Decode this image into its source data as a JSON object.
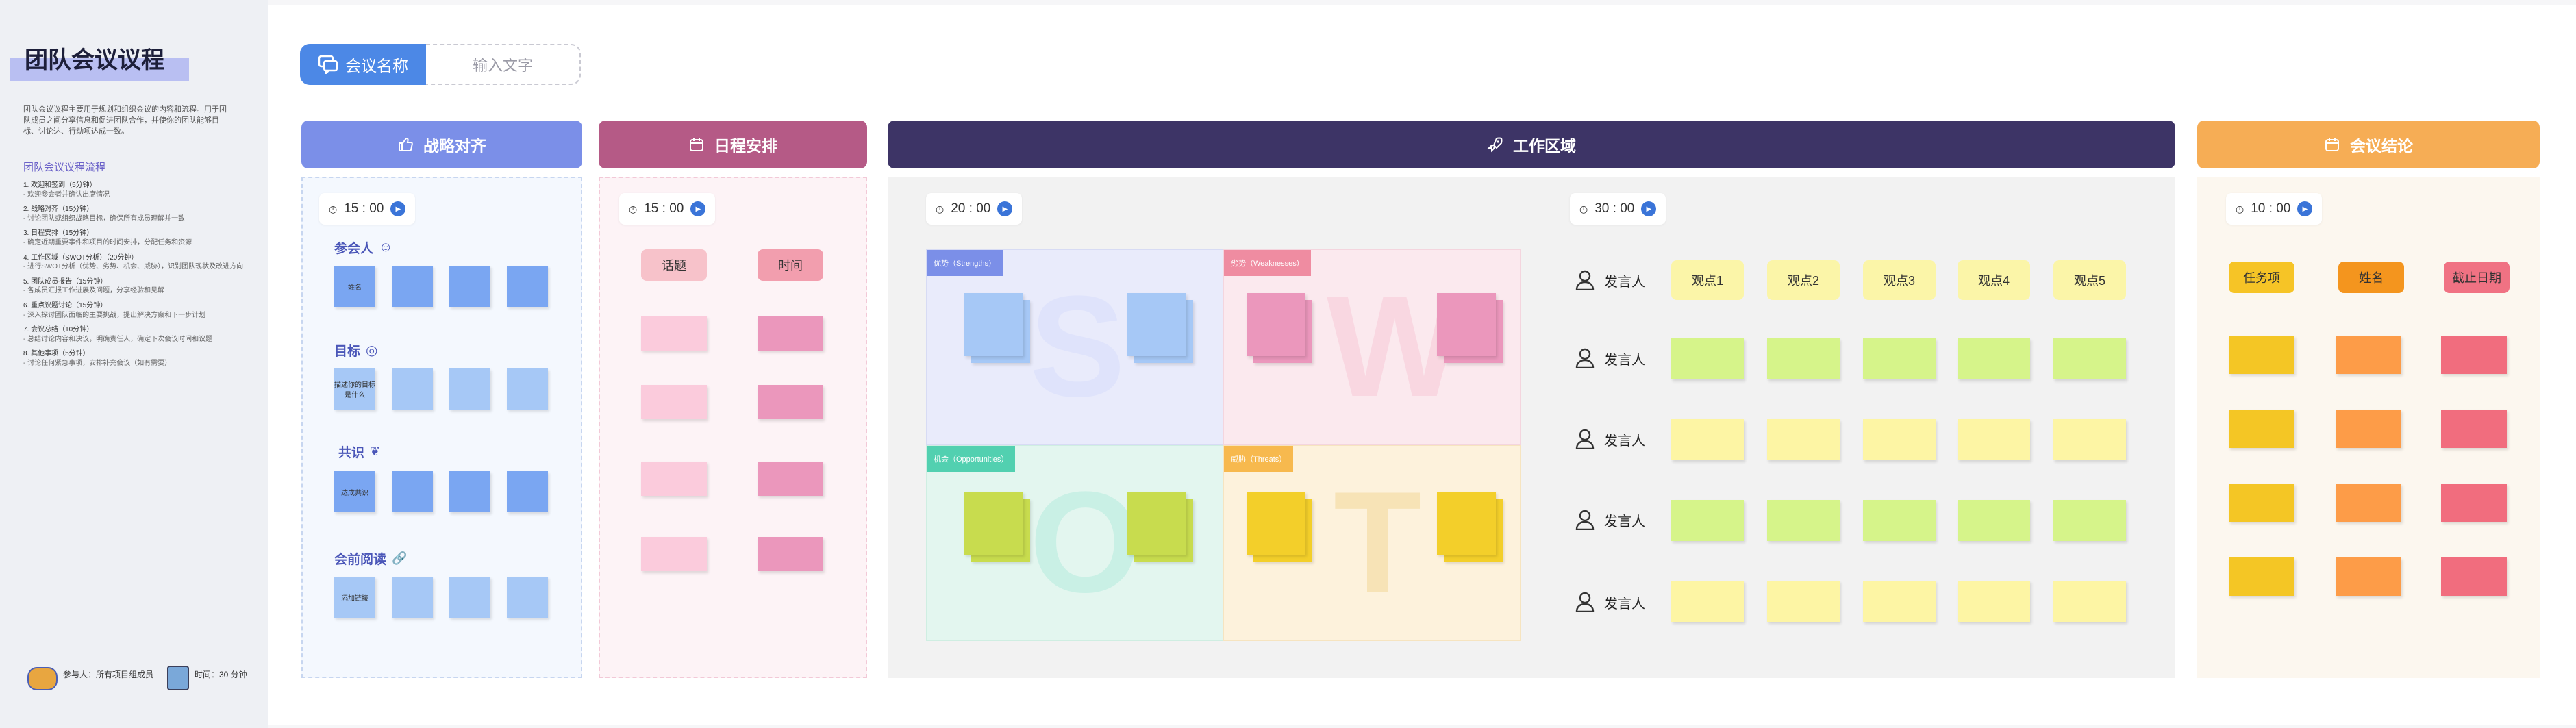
{
  "sidebar": {
    "title": "团队会议议程",
    "description": "团队会议议程主要用于规划和组织会议的内容和流程。用于团队成员之间分享信息和促进团队合作，并使你的团队能够目标、讨论达、行动项达成一致。",
    "flow_title": "团队会议议程流程",
    "steps": [
      {
        "title": "1. 欢迎和签到（5分钟）",
        "sub": "- 欢迎参会者并确认出席情况"
      },
      {
        "title": "2. 战略对齐（15分钟）",
        "sub": "- 讨论团队或组织战略目标，确保所有成员理解并一致"
      },
      {
        "title": "3. 日程安排（15分钟）",
        "sub": "- 确定近期重要事件和项目的时间安排，分配任务和资源"
      },
      {
        "title": "4. 工作区域（SWOT分析）（20分钟）",
        "sub": "- 进行SWOT分析（优势、劣势、机会、威胁），识别团队现状及改进方向"
      },
      {
        "title": "5. 团队成员报告（15分钟）",
        "sub": "- 各成员汇报工作进展及问题，分享经验和见解"
      },
      {
        "title": "6. 重点议题讨论（15分钟）",
        "sub": "- 深入探讨团队面临的主要挑战，提出解决方案和下一步计划"
      },
      {
        "title": "7. 会议总结（10分钟）",
        "sub": "- 总结讨论内容和决议，明确责任人，确定下次会议时间和议题"
      },
      {
        "title": "8. 其他事项（5分钟）",
        "sub": "- 讨论任何紧急事项，安排补充会议（如有需要）"
      }
    ],
    "participants": "参与人：所有项目组成员",
    "duration": "时间：30 分钟"
  },
  "meeting_name": {
    "label": "会议名称",
    "placeholder": "输入文字"
  },
  "strategy": {
    "header": "战略对齐",
    "timer": "15 : 00",
    "sections": [
      {
        "label": "参会人",
        "first_note": "姓名"
      },
      {
        "label": "目标",
        "first_note": "描述你的目标是什么"
      },
      {
        "label": "共识",
        "first_note": "达成共识"
      },
      {
        "label": "会前阅读",
        "first_note": "添加链接"
      }
    ]
  },
  "schedule": {
    "header": "日程安排",
    "timer": "15 : 00",
    "col1": "话题",
    "col2": "时间"
  },
  "work": {
    "header": "工作区域",
    "swot_timer": "20 : 00",
    "quads": [
      {
        "label": "优势（Strengths）",
        "letter": "S"
      },
      {
        "label": "劣势（Weaknesses）",
        "letter": "W"
      },
      {
        "label": "机会（Opportunities）",
        "letter": "O"
      },
      {
        "label": "威胁（Threats）",
        "letter": "T"
      }
    ],
    "view_timer": "30 : 00",
    "views": [
      "观点1",
      "观点2",
      "观点3",
      "观点4",
      "观点5"
    ],
    "speakers": [
      "发言人",
      "发言人",
      "发言人",
      "发言人",
      "发言人"
    ]
  },
  "conclusion": {
    "header": "会议结论",
    "timer": "10 : 00",
    "cols": [
      "任务项",
      "姓名",
      "截止日期"
    ]
  },
  "colors": {
    "strategy": "#7b8fe8",
    "schedule": "#b55a86",
    "work": "#3d3466",
    "conclusion": "#f6ad55",
    "blue_note": "#7aa6f2",
    "light_blue_note": "#a6c8f6"
  }
}
